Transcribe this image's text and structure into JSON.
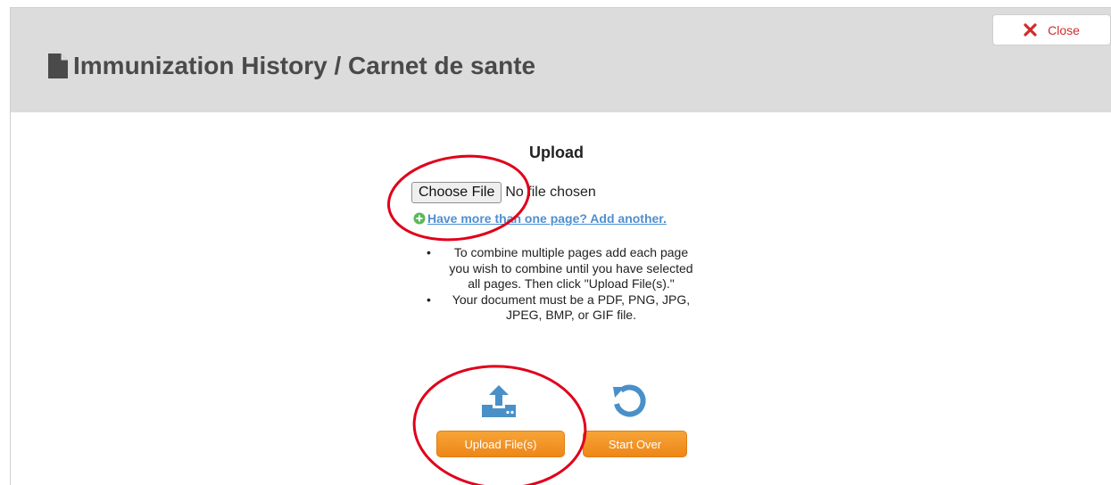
{
  "dialog": {
    "title": "Immunization History / Carnet de sante",
    "close_label": "Close"
  },
  "upload": {
    "heading": "Upload",
    "choose_file_label": "Choose File",
    "file_status": "No file chosen",
    "add_another_link": "Have more than one page? Add another.",
    "notes": [
      "To combine multiple pages add each page you wish to combine until you have selected all pages. Then click \"Upload File(s).\"",
      "Your document must be a PDF, PNG, JPG, JPEG, BMP, or GIF file."
    ],
    "upload_button": "Upload File(s)",
    "start_over_button": "Start Over"
  },
  "icons": {
    "document": "document-icon",
    "close": "close-x-icon",
    "add": "plus-circle-icon",
    "upload": "upload-icon",
    "start_over": "restart-icon"
  },
  "colors": {
    "header_bg": "#dcdcdc",
    "close_red": "#d02c2c",
    "link_blue": "#4f8fd0",
    "icon_blue": "#4a90c8",
    "button_orange": "#f29424",
    "annotation_red": "#e0001a"
  }
}
